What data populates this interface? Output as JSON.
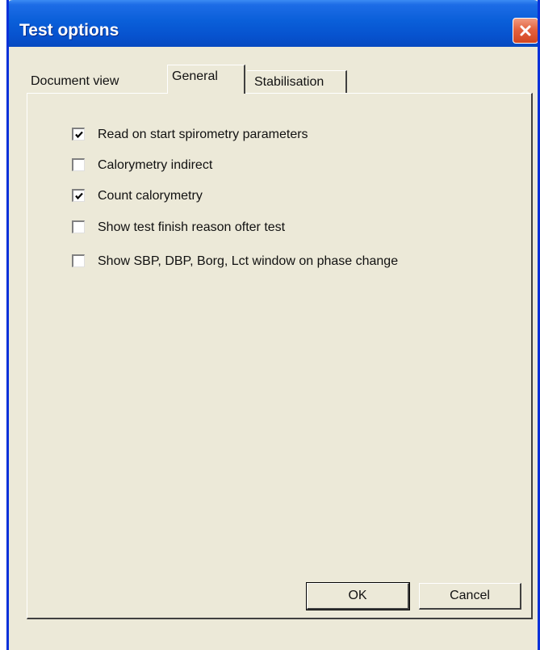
{
  "window": {
    "title": "Test options",
    "close_icon": "close-icon"
  },
  "tabs": [
    {
      "label": "Document view",
      "active": false
    },
    {
      "label": "General",
      "active": true
    },
    {
      "label": "Stabilisation",
      "active": false
    }
  ],
  "options": [
    {
      "label": "Read on start spirometry parameters",
      "checked": true
    },
    {
      "label": "Calorymetry indirect",
      "checked": false
    },
    {
      "label": "Count calorymetry",
      "checked": true
    },
    {
      "label": "Show test finish reason ofter test",
      "checked": false
    },
    {
      "label": "Show SBP, DBP, Borg, Lct window on phase change",
      "checked": false
    }
  ],
  "buttons": {
    "ok_label": "OK",
    "cancel_label": "Cancel"
  },
  "colors": {
    "titlebar": "#0a5fd9",
    "window_face": "#ece9d8",
    "close_button": "#e3623f"
  }
}
